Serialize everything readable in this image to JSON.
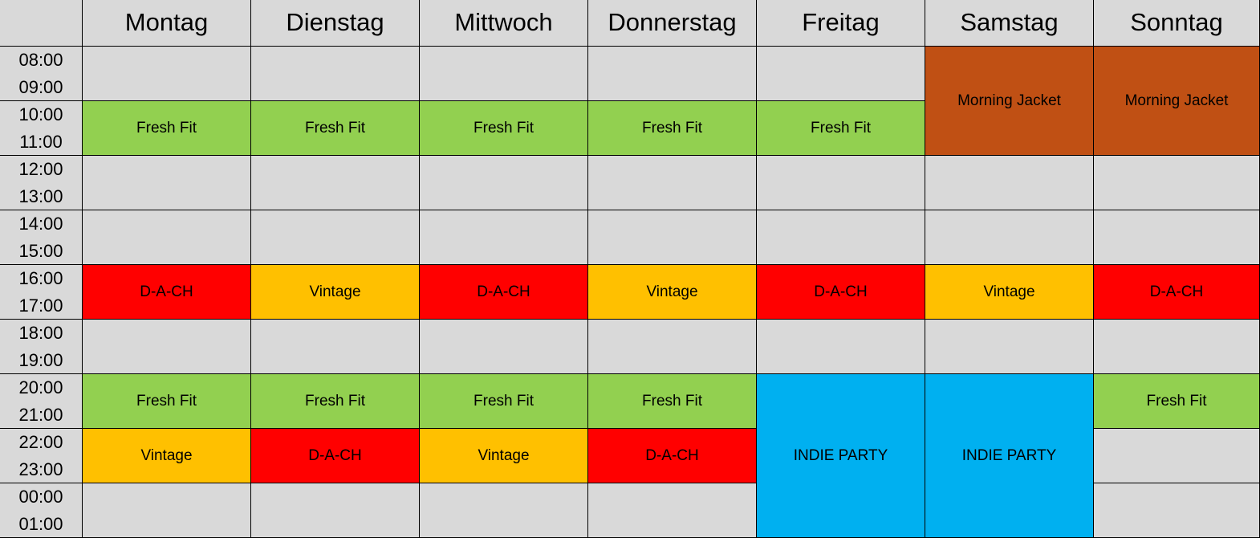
{
  "days": [
    "Montag",
    "Dienstag",
    "Mittwoch",
    "Donnerstag",
    "Freitag",
    "Samstag",
    "Sonntag"
  ],
  "time_labels": [
    [
      "08:00",
      "09:00"
    ],
    [
      "10:00",
      "11:00"
    ],
    [
      "12:00",
      "13:00"
    ],
    [
      "14:00",
      "15:00"
    ],
    [
      "16:00",
      "17:00"
    ],
    [
      "18:00",
      "19:00"
    ],
    [
      "20:00",
      "21:00"
    ],
    [
      "22:00",
      "23:00"
    ],
    [
      "00:00",
      "01:00"
    ]
  ],
  "legend_colors": {
    "Fresh Fit": "#92d050",
    "Vintage": "#ffc000",
    "D-A-CH": "#ff0000",
    "Morning Jacket": "#c05014",
    "INDIE PARTY": "#00b0f0"
  },
  "events": [
    {
      "day": 0,
      "start": 1,
      "span": 1,
      "label": "Fresh Fit"
    },
    {
      "day": 1,
      "start": 1,
      "span": 1,
      "label": "Fresh Fit"
    },
    {
      "day": 2,
      "start": 1,
      "span": 1,
      "label": "Fresh Fit"
    },
    {
      "day": 3,
      "start": 1,
      "span": 1,
      "label": "Fresh Fit"
    },
    {
      "day": 4,
      "start": 1,
      "span": 1,
      "label": "Fresh Fit"
    },
    {
      "day": 5,
      "start": 0,
      "span": 2,
      "label": "Morning Jacket"
    },
    {
      "day": 6,
      "start": 0,
      "span": 2,
      "label": "Morning Jacket"
    },
    {
      "day": 0,
      "start": 4,
      "span": 1,
      "label": "D-A-CH"
    },
    {
      "day": 1,
      "start": 4,
      "span": 1,
      "label": "Vintage"
    },
    {
      "day": 2,
      "start": 4,
      "span": 1,
      "label": "D-A-CH"
    },
    {
      "day": 3,
      "start": 4,
      "span": 1,
      "label": "Vintage"
    },
    {
      "day": 4,
      "start": 4,
      "span": 1,
      "label": "D-A-CH"
    },
    {
      "day": 5,
      "start": 4,
      "span": 1,
      "label": "Vintage"
    },
    {
      "day": 6,
      "start": 4,
      "span": 1,
      "label": "D-A-CH"
    },
    {
      "day": 0,
      "start": 6,
      "span": 1,
      "label": "Fresh Fit"
    },
    {
      "day": 1,
      "start": 6,
      "span": 1,
      "label": "Fresh Fit"
    },
    {
      "day": 2,
      "start": 6,
      "span": 1,
      "label": "Fresh Fit"
    },
    {
      "day": 3,
      "start": 6,
      "span": 1,
      "label": "Fresh Fit"
    },
    {
      "day": 4,
      "start": 6,
      "span": 3,
      "label": "INDIE PARTY"
    },
    {
      "day": 5,
      "start": 6,
      "span": 3,
      "label": "INDIE PARTY"
    },
    {
      "day": 6,
      "start": 6,
      "span": 1,
      "label": "Fresh Fit"
    },
    {
      "day": 0,
      "start": 7,
      "span": 1,
      "label": "Vintage"
    },
    {
      "day": 1,
      "start": 7,
      "span": 1,
      "label": "D-A-CH"
    },
    {
      "day": 2,
      "start": 7,
      "span": 1,
      "label": "Vintage"
    },
    {
      "day": 3,
      "start": 7,
      "span": 1,
      "label": "D-A-CH"
    }
  ]
}
